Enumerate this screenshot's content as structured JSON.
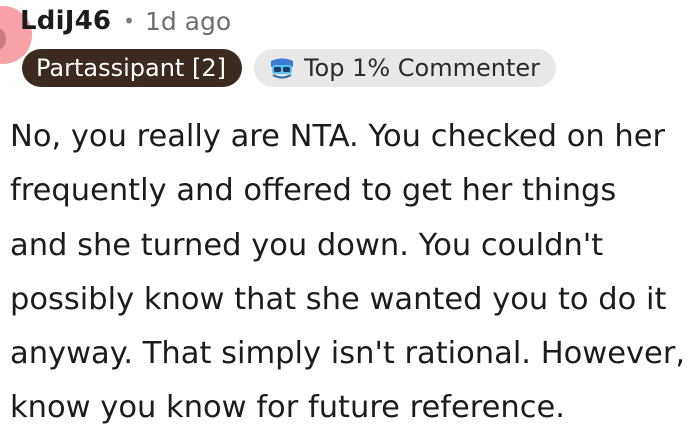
{
  "comment": {
    "username": "LdiJ46",
    "separator": "•",
    "timestamp": "1d ago",
    "user_flair": "Partassipant [2]",
    "top_badge_icon": "top-commenter-icon",
    "top_badge_label": "Top 1% Commenter",
    "body_lines": [
      "No, you really are NTA. You checked on her",
      "frequently and offered to get her things",
      "and she turned you down. You couldn't",
      "possibly know that she wanted you to do it",
      "anyway. That simply isn't rational. However,",
      "know you know for future reference."
    ]
  },
  "colors": {
    "avatar_bg": "#f6a2a8",
    "user_flair_bg": "#3b2a20",
    "top_badge_bg": "#e8e8e8",
    "text": "#1c1c1c",
    "meta_text": "#6f6f6f"
  }
}
